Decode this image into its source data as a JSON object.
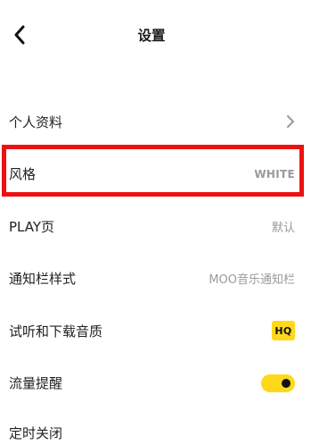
{
  "header": {
    "title": "设置",
    "back_icon": "chevron-left-icon"
  },
  "settings": [
    {
      "label": "个人资料",
      "icon": "chevron-right-icon"
    },
    {
      "label": "风格",
      "value": "WHITE",
      "highlighted": true
    },
    {
      "label": "PLAY页",
      "value": "默认"
    },
    {
      "label": "通知栏样式",
      "value": "MOO音乐通知栏"
    },
    {
      "label": "试听和下载音质",
      "badge": "HQ"
    },
    {
      "label": "流量提醒",
      "toggle": "on"
    },
    {
      "label": "定时关闭"
    }
  ],
  "colors": {
    "accent": "#ffd81a",
    "highlight_border": "#ee1111",
    "value_text": "#9a9a9a"
  }
}
